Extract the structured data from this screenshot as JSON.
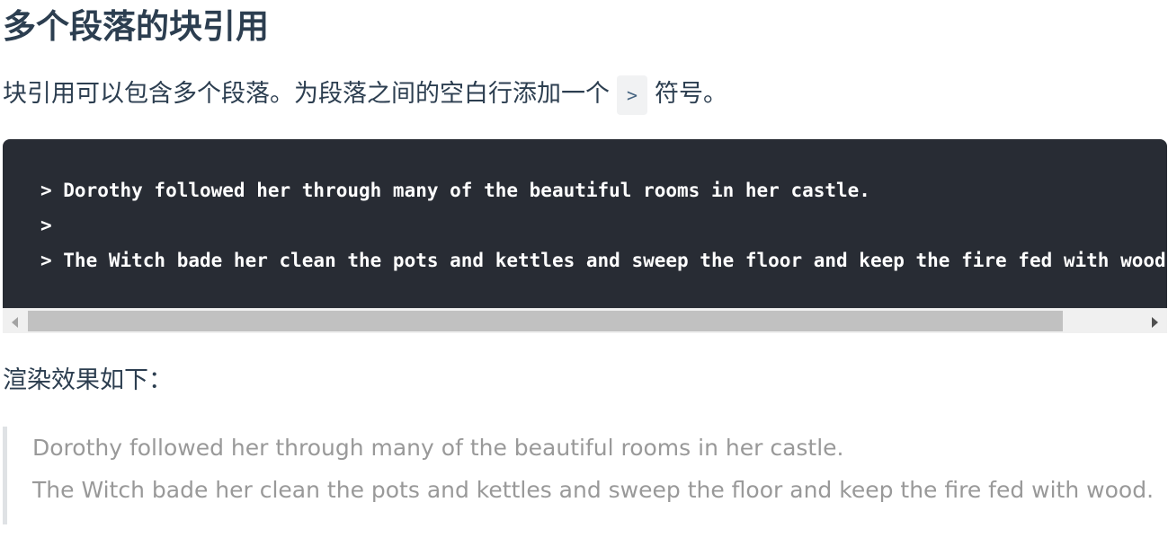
{
  "heading": "多个段落的块引用",
  "intro": {
    "text_before": "块引用可以包含多个段落。为段落之间的空白行添加一个",
    "inline_code": ">",
    "text_after": "符号。"
  },
  "code_block": {
    "lines": [
      "> Dorothy followed her through many of the beautiful rooms in her castle.",
      ">",
      "> The Witch bade her clean the pots and kettles and sweep the floor and keep the fire fed with wood."
    ],
    "background_color": "#282c34",
    "text_color": "#ffffff"
  },
  "render_label": "渲染效果如下：",
  "blockquote": {
    "paragraphs": [
      "Dorothy followed her through many of the beautiful rooms in her castle.",
      "The Witch bade her clean the pots and kettles and sweep the floor and keep the fire fed with wood."
    ],
    "text_color": "#999999",
    "border_color": "#dfe2e5"
  }
}
